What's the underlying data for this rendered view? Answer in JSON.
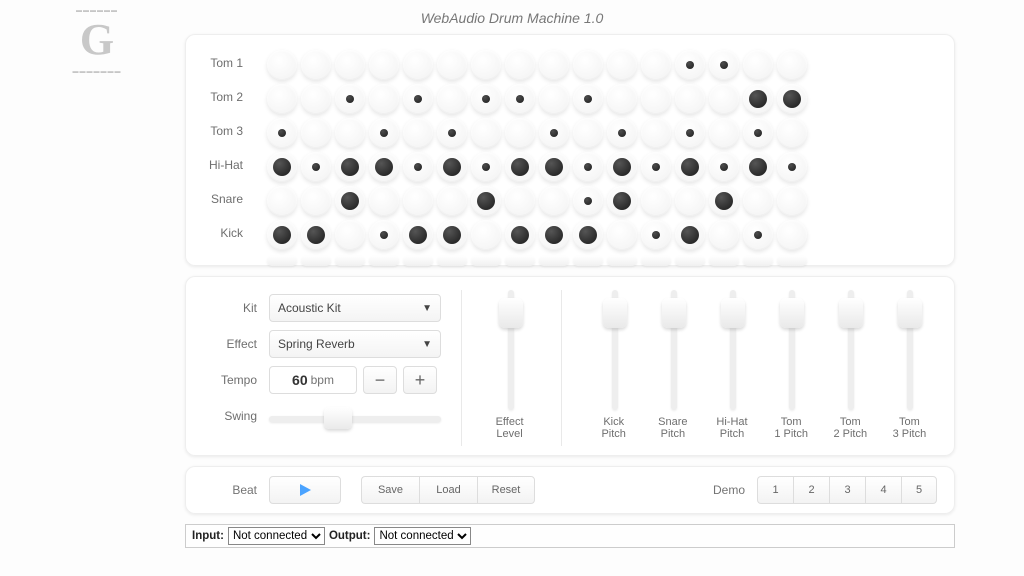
{
  "title": "WebAudio Drum Machine 1.0",
  "logo": {
    "top": "▬▬▬▬▬▬",
    "glyph": "G",
    "bottom": "▬▬▬▬▬▬▬"
  },
  "tracks": [
    {
      "name": "Tom 1",
      "steps": [
        0,
        0,
        0,
        0,
        0,
        0,
        0,
        0,
        0,
        0,
        0,
        0,
        1,
        1,
        0,
        0
      ]
    },
    {
      "name": "Tom 2",
      "steps": [
        0,
        0,
        1,
        0,
        1,
        0,
        1,
        1,
        0,
        1,
        0,
        0,
        0,
        0,
        2,
        2
      ]
    },
    {
      "name": "Tom 3",
      "steps": [
        1,
        0,
        0,
        1,
        0,
        1,
        0,
        0,
        1,
        0,
        1,
        0,
        1,
        0,
        1,
        0
      ]
    },
    {
      "name": "Hi-Hat",
      "steps": [
        2,
        1,
        2,
        2,
        1,
        2,
        1,
        2,
        2,
        1,
        2,
        1,
        2,
        1,
        2,
        1
      ]
    },
    {
      "name": "Snare",
      "steps": [
        0,
        0,
        2,
        0,
        0,
        0,
        2,
        0,
        0,
        1,
        2,
        0,
        0,
        2,
        0,
        0
      ]
    },
    {
      "name": "Kick",
      "steps": [
        2,
        2,
        0,
        1,
        2,
        2,
        0,
        2,
        2,
        2,
        0,
        1,
        2,
        0,
        1,
        0
      ]
    }
  ],
  "controls": {
    "kit": {
      "label": "Kit",
      "value": "Acoustic Kit"
    },
    "effect": {
      "label": "Effect",
      "value": "Spring Reverb"
    },
    "tempo": {
      "label": "Tempo",
      "value": 60,
      "unit": "bpm"
    },
    "swing": {
      "label": "Swing",
      "value": 0.32
    }
  },
  "sliders": [
    {
      "label": "Effect Level"
    },
    {
      "label": "Kick Pitch"
    },
    {
      "label": "Snare Pitch"
    },
    {
      "label": "Hi-Hat Pitch"
    },
    {
      "label": "Tom 1 Pitch"
    },
    {
      "label": "Tom 2 Pitch"
    },
    {
      "label": "Tom 3 Pitch"
    }
  ],
  "transport": {
    "beat_label": "Beat",
    "save": "Save",
    "load": "Load",
    "reset": "Reset",
    "demo_label": "Demo",
    "demos": [
      "1",
      "2",
      "3",
      "4",
      "5"
    ]
  },
  "io": {
    "input_label": "Input:",
    "input_value": "Not connected",
    "output_label": "Output:",
    "output_value": "Not connected"
  }
}
